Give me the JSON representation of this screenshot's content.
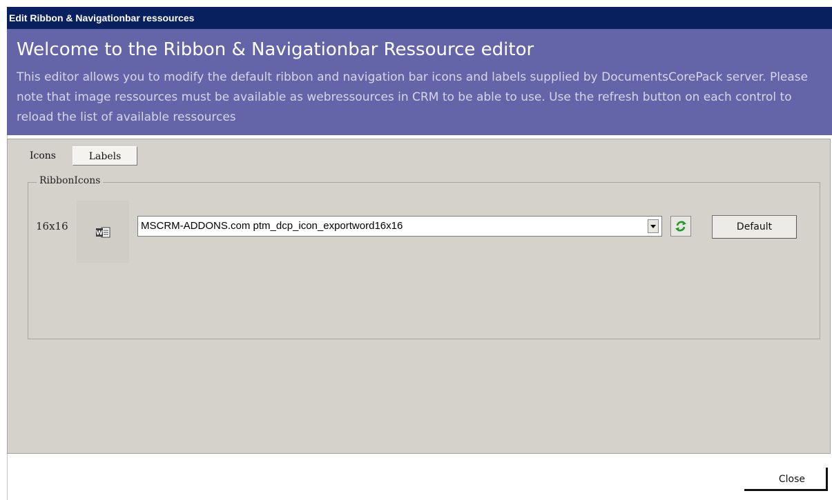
{
  "window": {
    "title": "Edit Ribbon & Navigationbar ressources"
  },
  "header": {
    "heading": "Welcome to the Ribbon & Navigationbar Ressource editor",
    "description": "This editor allows you to modify the default ribbon and navigation bar icons and labels supplied by DocumentsCorePack server. Please note that image ressources must be available as webressources in CRM to be able to use. Use the refresh button on each control to reload the list of available ressources"
  },
  "tabs": [
    {
      "label": "Icons",
      "selected": true
    },
    {
      "label": "Labels",
      "selected": false
    }
  ],
  "ribbon_icons": {
    "legend": "RibbonIcons",
    "size_label": "16x16",
    "preview_icon": "word-document-icon",
    "selected_resource": "MSCRM-ADDONS.com ptm_dcp_icon_exportword16x16",
    "refresh_icon": "refresh-icon",
    "default_label": "Default"
  },
  "footer": {
    "close_label": "Close"
  },
  "colors": {
    "titlebar": "#09205e",
    "header": "#6464a8",
    "panel": "#d5d2cc"
  }
}
